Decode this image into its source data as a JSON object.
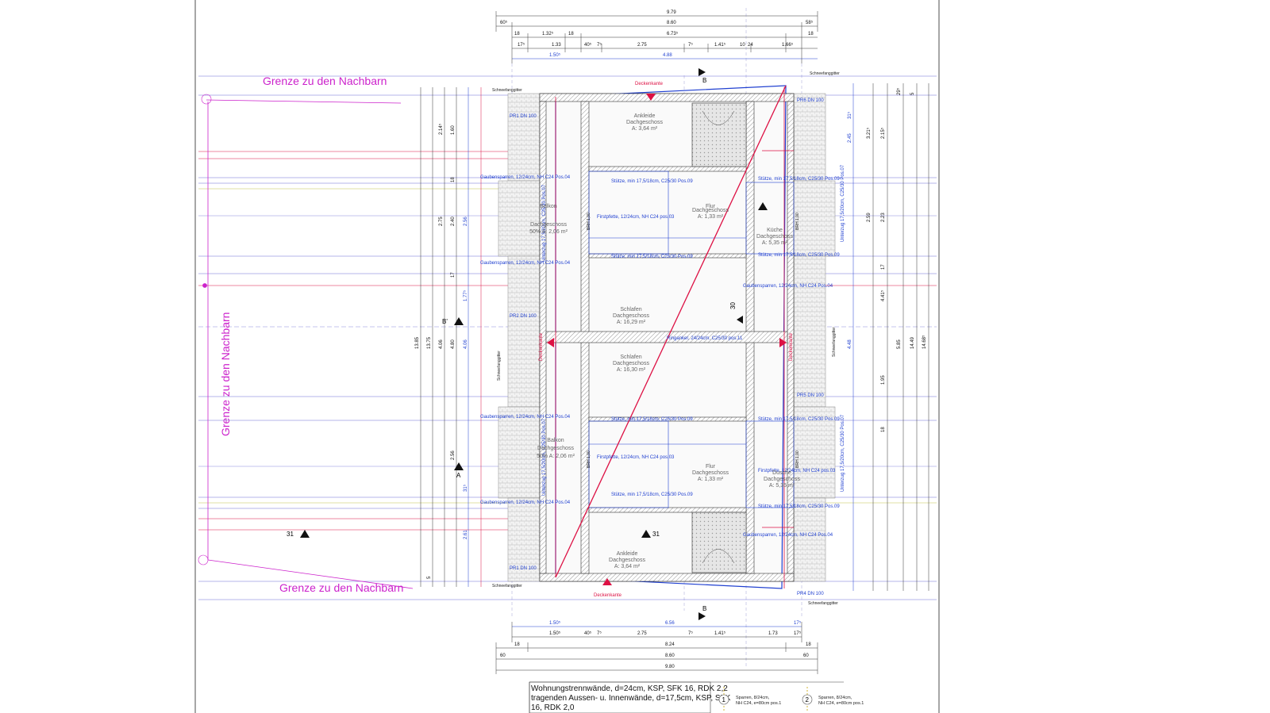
{
  "top_dims": {
    "overall": "9.79",
    "row2": [
      "60⁵",
      "8.60",
      "58⁵"
    ],
    "row3": [
      "18",
      "1.32⁵",
      "18",
      "6.73⁵",
      "18"
    ],
    "row4": [
      "17⁵",
      "1.33",
      "40⁵",
      "7⁵",
      "2.75",
      "7⁵",
      "1.41⁵",
      "10",
      "24",
      "1.66⁵"
    ],
    "row5": [
      "1.50⁵",
      "4.88"
    ]
  },
  "bottom_dims": {
    "row1": [
      "1.50⁵",
      "6.56",
      "17⁵"
    ],
    "row2": [
      "1.50⁵",
      "40⁵",
      "7⁵",
      "2.75",
      "7⁵",
      "1.41⁵",
      "1.73",
      "17⁵"
    ],
    "row3": [
      "18",
      "8.24",
      "18"
    ],
    "row4": [
      "60",
      "8.60",
      "60"
    ],
    "overall": "9.80"
  },
  "left_dims": [
    "13.85",
    "13.75",
    "4.06",
    "4.80",
    "4.06",
    "2.75",
    "2.40",
    "2.56",
    "2.61",
    "2.14⁵",
    "1.60",
    "1.77⁵",
    "18",
    "17",
    "31⁵",
    "5",
    "2.56"
  ],
  "right_dims": [
    "14.68⁵",
    "14.49",
    "5.85",
    "4.41⁵",
    "4.48",
    "2.59",
    "2.23",
    "1.95",
    "17",
    "18",
    "31⁵",
    "3.21⁵",
    "2.45",
    "2.15⁵",
    "29⁵",
    "5"
  ],
  "grenze": {
    "top": "Grenze  zu den Nachbarn",
    "left": "Grenze  zu den Nachbarn",
    "bottom": "Grenze  zu den Nachbarn"
  },
  "section_marks": {
    "b_top": "B",
    "b_bottom": "B",
    "b_left": "B'",
    "a_left": "A",
    "a_right": "A'",
    "n31_left": "31",
    "n31_center": "31",
    "n30": "30"
  },
  "labels": {
    "schneefang": "Schneefanggitter",
    "deckenkante": "Deckenkante",
    "pr1_top": "PR1\nDN 100",
    "pr1_bottom": "PR1\nDN 100",
    "pr2": "PR2\nDN 100",
    "pr5": "PR5\nDN 100",
    "pr6": "PR6\nDN 100",
    "pr4": "PR4\nDN 100",
    "gaubensparren": "Gaubensparren, 12/24cm, NH C24 Pos.04",
    "stutze": "Stütze, min 17,5/18cm, C25/30 Pos.09",
    "firstpfette": "Firstpfette, 12/24cm, NH C24 pos.03",
    "ringanker": "Ringanker, 24/24cm, C25/30 pos.11",
    "unterzug_left": "Unterzug 17,5/20cm, C25/30 Pos.07",
    "unterzug_right": "Unterzug 17,5/20cm, C25/30 Pos.07",
    "balkon": "Balkon",
    "brh": "BRH 1,00"
  },
  "rooms": [
    {
      "name": "Ankleide",
      "level": "Dachgeschoss",
      "area": "A: 3,64 m²"
    },
    {
      "name": "Balkon",
      "level": "Dachgeschoss",
      "area": "50% A: 2,06 m²"
    },
    {
      "name": "Flur",
      "level": "Dachgeschoss",
      "area": "A: 1,33 m²"
    },
    {
      "name": "Küche",
      "level": "Dachgeschoss",
      "area": "A: 5,35 m²"
    },
    {
      "name": "Schlafen",
      "level": "Dachgeschoss",
      "area": "A: 16,29 m²"
    },
    {
      "name": "Schlafen",
      "level": "Dachgeschoss",
      "area": "A: 16,30 m²"
    },
    {
      "name": "Balkon",
      "level": "Dachgeschoss",
      "area": "50% A: 2,06 m²"
    },
    {
      "name": "Flur",
      "level": "Dachgeschoss",
      "area": "A: 1,33 m²"
    },
    {
      "name": "Dusche",
      "level": "Dachgeschoss",
      "area": "A: 5,35 m²"
    },
    {
      "name": "Ankleide",
      "level": "Dachgeschoss",
      "area": "A: 3,64 m²"
    }
  ],
  "legend": {
    "text": "Wohnungstrennwände, d=24cm, KSP, SFK 16, RDK 2,2 tragenden Aussen- u. Innenwände, d=17,5cm, KSP, SFK 16, RDK 2,0",
    "line1": "Wohnungstrennwände, d=24cm, KSP, SFK 16, RDK 2,2",
    "line2": "tragenden Aussen- u. Innenwände, d=17,5cm, KSP, SFK",
    "line3": "16, RDK 2,0",
    "item1_num": "1",
    "item1_text1": "Sparren, 8/24cm,",
    "item1_text2": "NH C24, e=80cm pos.1",
    "item2_num": "2",
    "item2_text1": "Sparren, 8/24cm,",
    "item2_text2": "NH C24, e=80cm pos.1"
  },
  "colors": {
    "magenta": "#cc22cc",
    "red": "#dd1144",
    "blue": "#1f3fd0",
    "hatch": "#555555"
  }
}
